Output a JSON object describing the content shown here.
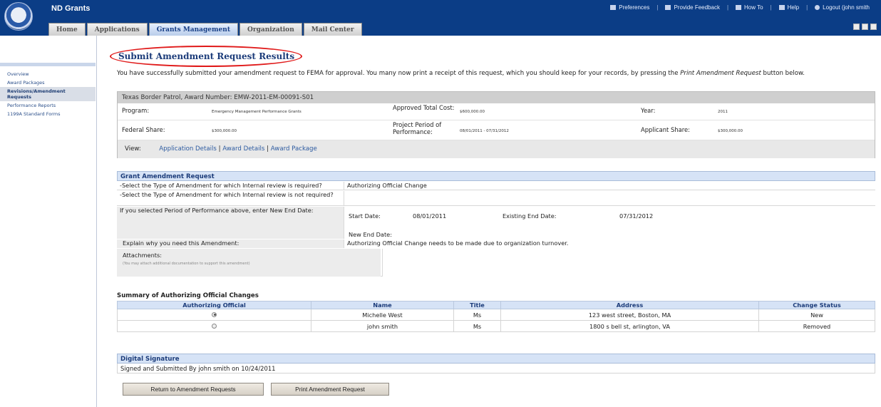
{
  "header": {
    "app_name": "ND Grants",
    "links": [
      "Preferences",
      "Provide Feedback",
      "How To",
      "Help",
      "Logout (john smith"
    ],
    "tabs": [
      "Home",
      "Applications",
      "Grants Management",
      "Organization",
      "Mail Center"
    ],
    "active_tab": "Grants Management"
  },
  "sidebar": {
    "items": [
      {
        "label": "Overview"
      },
      {
        "label": "Award Packages"
      },
      {
        "label": "Revisions/Amendment Requests"
      },
      {
        "label": "Performance Reports"
      },
      {
        "label": "1199A Standard Forms"
      }
    ],
    "active_index": 2
  },
  "main": {
    "title": "Submit Amendment Request Results",
    "intro_before": "You have successfully submitted your amendment request to FEMA for approval. You many now print a receipt of this request, which you should keep for your records, by pressing the ",
    "intro_italic": "Print Amendment Request",
    "intro_after": " button below."
  },
  "award": {
    "header": "Texas Border Patrol, Award Number: EMW-2011-EM-00091-S01",
    "program_label": "Program:",
    "program_value": "Emergency Management Performance Grants",
    "approved_cost_label": "Approved Total Cost:",
    "approved_cost_value": "$600,000.00",
    "year_label": "Year:",
    "year_value": "2011",
    "federal_share_label": "Federal Share:",
    "federal_share_value": "$300,000.00",
    "project_period_label": "Project Period of Performance:",
    "project_period_value": "08/01/2011 - 07/31/2012",
    "applicant_share_label": "Applicant Share:",
    "applicant_share_value": "$300,000.00",
    "view_label": "View:",
    "view_links": [
      "Application Details",
      "Award Details",
      "Award Package"
    ]
  },
  "amendment": {
    "section_title": "Grant Amendment Request",
    "row1_label": "-Select the Type of Amendment for which Internal review is required?",
    "row1_value": "Authorizing Official Change",
    "row2_label": "-Select the Type of Amendment for which Internal review is not required?",
    "row3_label": "If you selected Period of Performance above, enter New End Date:",
    "start_date_label": "Start Date:",
    "start_date_value": "08/01/2011",
    "existing_end_label": "Existing End Date:",
    "existing_end_value": "07/31/2012",
    "new_end_label": "New End Date:",
    "explain_label": "Explain why you need this Amendment:",
    "explain_value": "Authorizing Official Change needs to be made due to organization turnover.",
    "attachments_label": "Attachments:",
    "attachments_note": "(You may attach additional documentation to support this amendment)"
  },
  "summary": {
    "title": "Summary of Authorizing Official Changes",
    "columns": [
      "Authorizing Official",
      "Name",
      "Title",
      "Address",
      "Change Status"
    ],
    "rows": [
      {
        "selected": true,
        "name": "Michelle West",
        "title": "Ms",
        "address": "123 west street, Boston, MA",
        "status": "New"
      },
      {
        "selected": false,
        "name": "john smith",
        "title": "Ms",
        "address": "1800 s bell st, arlington, VA",
        "status": "Removed"
      }
    ]
  },
  "signature": {
    "title": "Digital Signature",
    "text": "Signed and Submitted By john smith on 10/24/2011"
  },
  "buttons": {
    "return": "Return to Amendment Requests",
    "print": "Print Amendment Request"
  },
  "colors": {
    "header_bg": "#0b3d86",
    "title_text": "#1c3c7a",
    "highlight_oval": "#e01a1a",
    "section_bg": "#d6e3f6"
  }
}
